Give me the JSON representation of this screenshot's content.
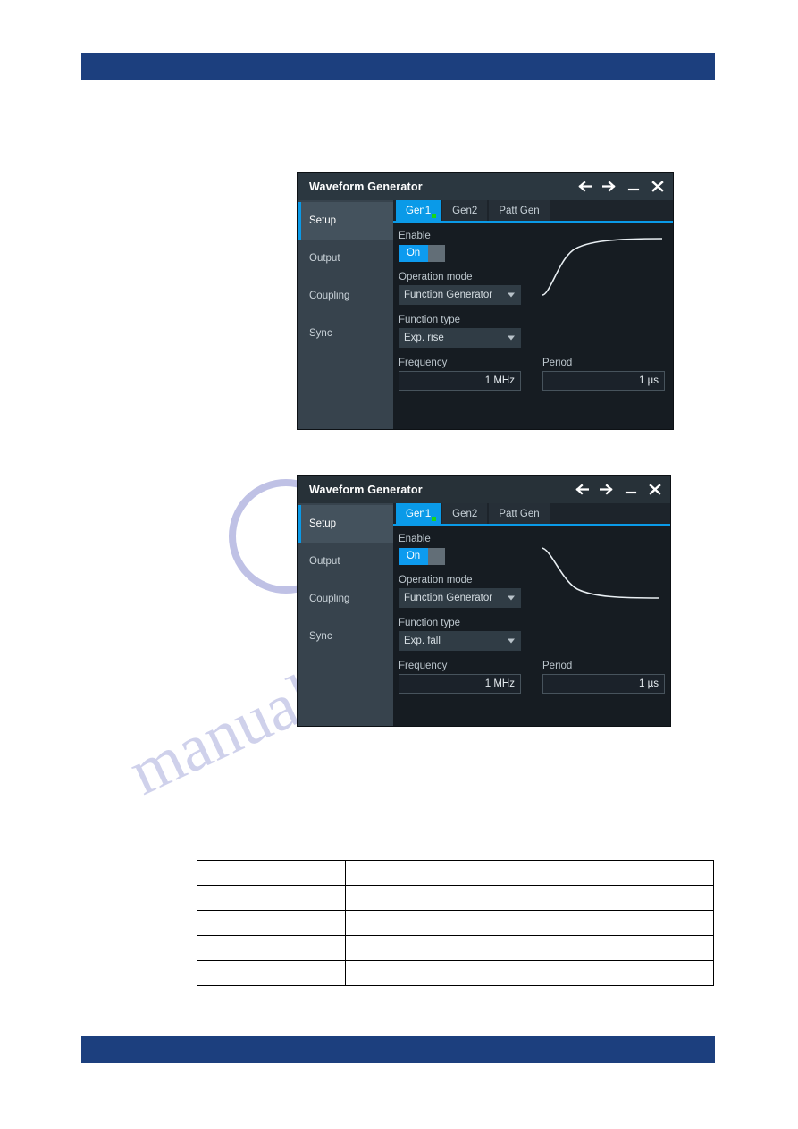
{
  "page": {
    "header_bar": {
      "label": ""
    },
    "footer_bar": {
      "label": ""
    },
    "accent_blue": "#1c3f7e"
  },
  "watermark": {
    "text": "manualslive.com"
  },
  "panels": [
    {
      "id": "panel-1",
      "title": "Waveform Generator",
      "controls": [
        {
          "name": "back-arrow-icon",
          "glyph": "←"
        },
        {
          "name": "forward-arrow-icon",
          "glyph": "→"
        },
        {
          "name": "minimize-icon",
          "glyph": "—"
        },
        {
          "name": "close-icon",
          "glyph": "✕"
        }
      ],
      "sidebar": [
        {
          "label": "Setup",
          "active": true
        },
        {
          "label": "Output",
          "active": false
        },
        {
          "label": "Coupling",
          "active": false
        },
        {
          "label": "Sync",
          "active": false
        }
      ],
      "tabs": [
        {
          "label": "Gen1",
          "active": true,
          "indicator": "#18d81a"
        },
        {
          "label": "Gen2",
          "active": false
        },
        {
          "label": "Patt Gen",
          "active": false
        }
      ],
      "fields": {
        "enable_label": "Enable",
        "enable_value": "On",
        "operation_mode_label": "Operation mode",
        "operation_mode_value": "Function Generator",
        "function_type_label": "Function type",
        "function_type_value": "Exp. rise",
        "frequency_label": "Frequency",
        "frequency_value": "1 MHz",
        "period_label": "Period",
        "period_value": "1 µs"
      },
      "waveform": {
        "shape": "exponential-rise"
      }
    },
    {
      "id": "panel-2",
      "title": "Waveform Generator",
      "controls": [
        {
          "name": "back-arrow-icon",
          "glyph": "←"
        },
        {
          "name": "forward-arrow-icon",
          "glyph": "→"
        },
        {
          "name": "minimize-icon",
          "glyph": "—"
        },
        {
          "name": "close-icon",
          "glyph": "✕"
        }
      ],
      "sidebar": [
        {
          "label": "Setup",
          "active": true
        },
        {
          "label": "Output",
          "active": false
        },
        {
          "label": "Coupling",
          "active": false
        },
        {
          "label": "Sync",
          "active": false
        }
      ],
      "tabs": [
        {
          "label": "Gen1",
          "active": true,
          "indicator": "#18d81a"
        },
        {
          "label": "Gen2",
          "active": false
        },
        {
          "label": "Patt Gen",
          "active": false
        }
      ],
      "fields": {
        "enable_label": "Enable",
        "enable_value": "On",
        "operation_mode_label": "Operation mode",
        "operation_mode_value": "Function Generator",
        "function_type_label": "Function type",
        "function_type_value": "Exp. fall",
        "frequency_label": "Frequency",
        "frequency_value": "1 MHz",
        "period_label": "Period",
        "period_value": "1 µs"
      },
      "waveform": {
        "shape": "exponential-fall"
      }
    }
  ],
  "table": {
    "rows": [
      [
        "",
        "",
        ""
      ],
      [
        "",
        "",
        ""
      ],
      [
        "",
        "",
        ""
      ],
      [
        "",
        "",
        ""
      ],
      [
        "",
        "",
        ""
      ]
    ]
  }
}
